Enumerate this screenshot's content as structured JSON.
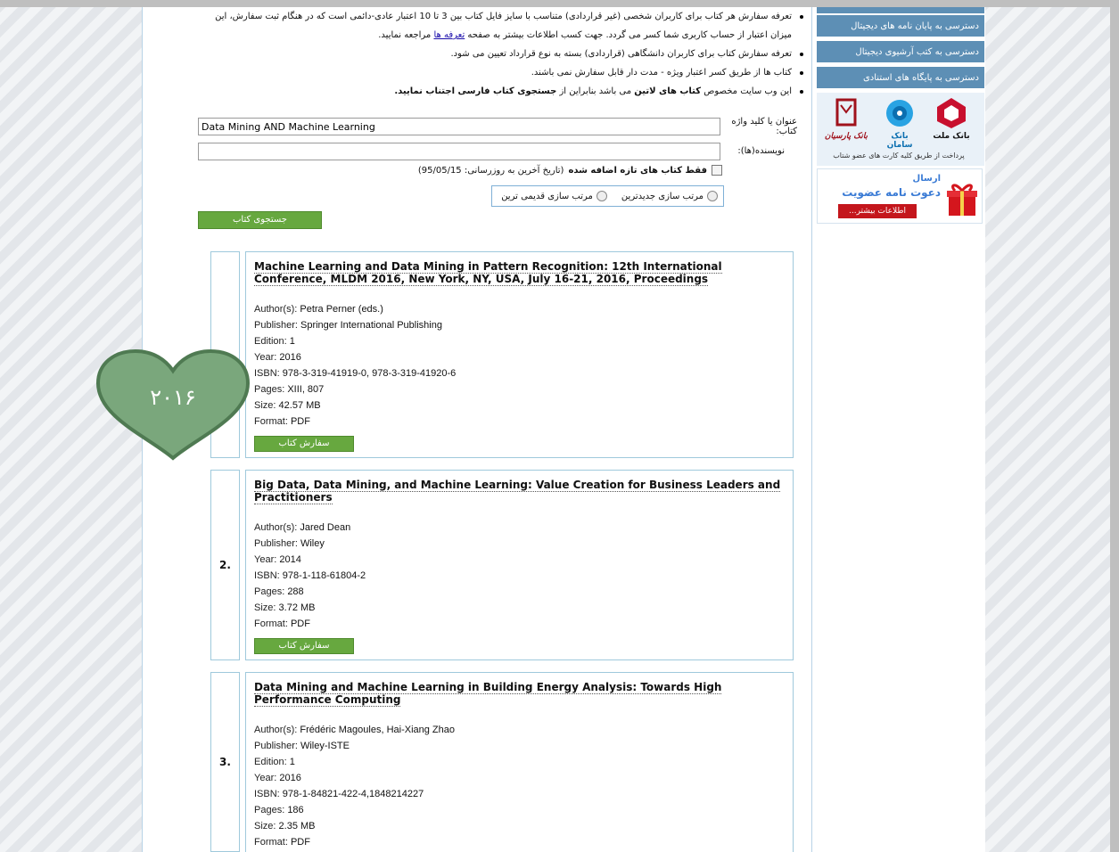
{
  "notes": [
    {
      "text": "تعرفه سفارش هر کتاب برای کاربران شخصی (غیر قراردادی) متناسب با سایز فایل کتاب بین 3 تا 10 اعتبار عادی-دائمی است که در هنگام ثبت سفارش، این",
      "bullet": true
    },
    {
      "pre": "میزان اعتبار از حساب کاربری شما کسر می گردد. جهت کسب اطلاعات بیشتر به صفحه ",
      "link": "تعرفه ها",
      "post": " مراجعه نمایید.",
      "bullet": false
    },
    {
      "text": "تعرفه سفارش کتاب برای کاربران دانشگاهی (قراردادی) بسته به نوع قرارداد تعیین می شود.",
      "bullet": true
    },
    {
      "text": "کتاب ها از طریق کسر اعتبار ویژه - مدت دار قابل سفارش نمی باشند.",
      "bullet": true
    },
    {
      "p1": "این وب سایت مخصوص ",
      "b1": "کتاب های لاتین",
      "p2": " می باشد بنابراین از ",
      "b2": "جستجوی کتاب فارسی",
      "p3": " اجتناب نمایید.",
      "bullet": true
    }
  ],
  "form": {
    "title_label": "عنوان یا کلید واژه کتاب:",
    "title_value": "Data Mining AND Machine Learning",
    "author_label": "نویسنده(ها):",
    "author_value": "",
    "new_only_label": "فقط کتاب های تازه اضافه شده",
    "update_note": "(تاریخ آخرین به روزرسانی: 95/05/15)",
    "sort_newest": "مرتب سازی جدیدترین",
    "sort_oldest": "مرتب سازی قدیمی ترین",
    "search_button": "جستجوی کتاب"
  },
  "labels": {
    "author": "Author(s):",
    "publisher": "Publisher:",
    "edition": "Edition:",
    "year": "Year:",
    "isbn": "ISBN:",
    "pages": "Pages:",
    "size": "Size:",
    "format": "Format:"
  },
  "order_button": "سفارش کتاب",
  "results": [
    {
      "num": "",
      "title": "Machine Learning and Data Mining in Pattern Recognition: 12th International Conference, MLDM 2016, New York, NY, USA, July 16-21, 2016, Proceedings",
      "author": "Petra Perner (eds.)",
      "publisher": "Springer International Publishing",
      "edition": "1",
      "year": "2016",
      "isbn": "978-3-319-41919-0, 978-3-319-41920-6",
      "pages": "XIII, 807",
      "size": "42.57 MB",
      "format": "PDF"
    },
    {
      "num": "2.",
      "title": "Big Data, Data Mining, and Machine Learning: Value Creation for Business Leaders and Practitioners",
      "author": "Jared Dean",
      "publisher": "Wiley",
      "year": "2014",
      "isbn": "978-1-118-61804-2",
      "pages": "288",
      "size": "3.72 MB",
      "format": "PDF"
    },
    {
      "num": "3.",
      "title": "Data Mining and Machine Learning in Building Energy Analysis: Towards High Performance Computing",
      "author": "Frédéric Magoules, Hai-Xiang Zhao",
      "publisher": "Wiley-ISTE",
      "edition": "1",
      "year": "2016",
      "isbn": "978-1-84821-422-4,1848214227",
      "pages": "186",
      "size": "2.35 MB",
      "format": "PDF"
    }
  ],
  "heart_badge": {
    "text": "۲۰۱۶",
    "color": "#7aa77c",
    "border": "#4f7a52"
  },
  "sidebar": {
    "links": [
      "دسترسی به پایان نامه های دیجیتال",
      "دسترسی به کتب آرشیوی دیجیتال",
      "دسترسی به پایگاه های استنادی"
    ],
    "banks": [
      "بانک ملت",
      "بانک سامان",
      "بانک پارسیان"
    ],
    "pay_text": "پرداخت از طریق کلیه کارت های عضو شتاب",
    "invite_line1": "ارسال",
    "invite_line2": "دعوت نامه عضویت",
    "more": "اطلاعات بیشتر..."
  },
  "colors": {
    "nav_bg": "#5d8fb5",
    "green_button": "#67a83f",
    "accent_red": "#c4161c"
  }
}
